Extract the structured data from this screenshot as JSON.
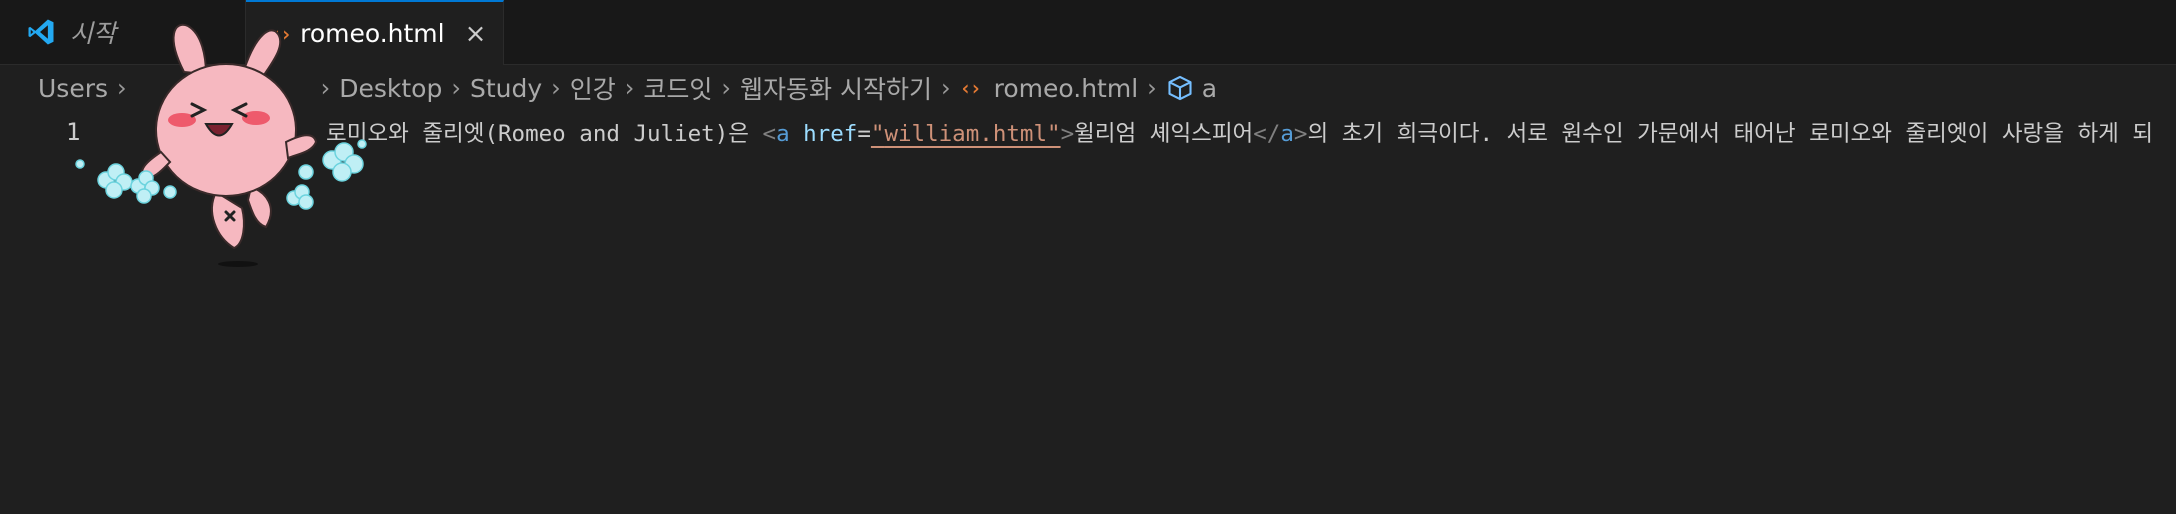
{
  "tabs": [
    {
      "label": "시작",
      "icon": "vscode-logo-icon",
      "active": false
    },
    {
      "label": "romeo.html",
      "icon": "html-file-icon",
      "active": true,
      "close": "×"
    }
  ],
  "breadcrumb": {
    "items": [
      "Users",
      "Desktop",
      "Study",
      "인강",
      "코드잇",
      "웹자동화 시작하기",
      "romeo.html",
      "a"
    ],
    "separator": "›"
  },
  "editor": {
    "line_number": "1",
    "code": {
      "text_before": "로미오와 줄리엣(Romeo and Juliet)은 ",
      "lt": "<",
      "tag": "a",
      "attr": "href",
      "eq": "=",
      "quote_open": "\"",
      "href": "william.html",
      "quote_close": "\"",
      "gt": ">",
      "link_text": "윌리엄 셰익스피어",
      "close_lt": "</",
      "close_tag": "a",
      "close_gt": ">",
      "text_after": "의 초기 희극이다. 서로 원수인 가문에서 태어난 로미오와 줄리엣이 사랑을 하게 되"
    }
  },
  "colors": {
    "accent": "#0078d4",
    "html_icon": "#e37933",
    "tag": "#569cd6",
    "attribute": "#9cdcfe",
    "string": "#ce9178",
    "sticker_pink": "#f6b8c0",
    "sticker_flower": "#bfeff5"
  },
  "sticker": {
    "icon": "pink-bunny-sticker"
  }
}
